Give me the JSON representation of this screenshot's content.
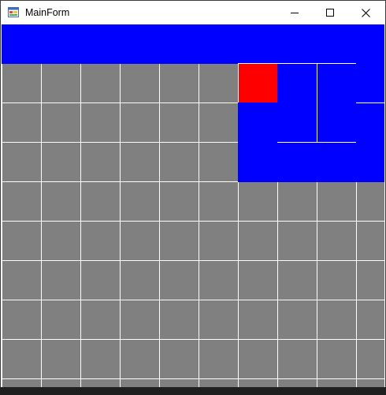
{
  "window": {
    "title": "MainForm"
  },
  "icons": {
    "app": "app-form-icon",
    "minimize": "minimize-icon",
    "maximize": "maximize-icon",
    "close": "close-icon"
  },
  "colors": {
    "background": "#808080",
    "grid_line": "#ffffff",
    "blue": "#0000ff",
    "red": "#ff0000"
  },
  "board": {
    "columns": 10,
    "rows": 9,
    "blue_regions": [
      {
        "col": 0,
        "row": -1,
        "cols": 10,
        "rows": 1
      },
      {
        "col": 6,
        "row": 1,
        "cols": 4,
        "rows": 2
      },
      {
        "col": 7,
        "row": 0,
        "cols": 2,
        "rows": 1
      },
      {
        "col": 9,
        "row": 0,
        "cols": 1,
        "rows": 1
      }
    ],
    "red_cells": [
      {
        "col": 6,
        "row": 0
      }
    ]
  }
}
